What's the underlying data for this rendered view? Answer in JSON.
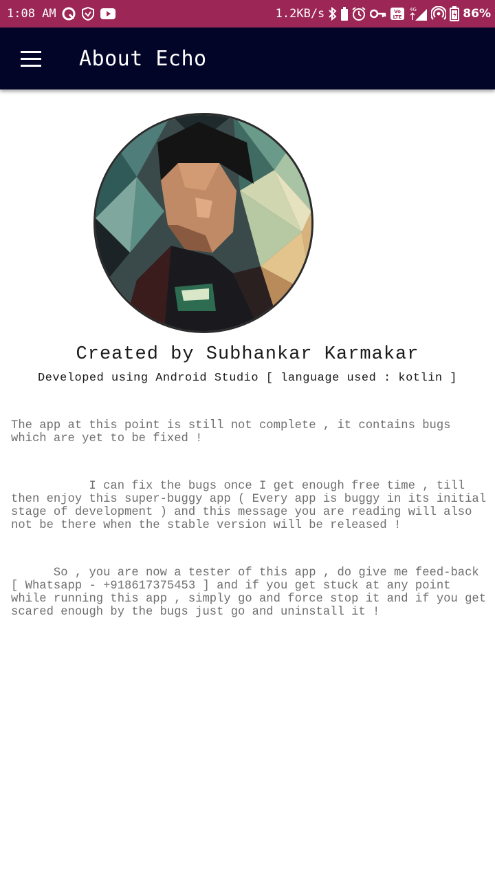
{
  "status_bar": {
    "time": "1:08 AM",
    "net_speed": "1.2KB/s",
    "battery_percent": "86%",
    "network_label": "4G",
    "volte_label": "VoLTE"
  },
  "app_bar": {
    "title": "About Echo"
  },
  "profile": {
    "creator_line": "Created by Subhankar Karmakar",
    "developer_line": "Developed using Android Studio [ language used : kotlin ]"
  },
  "about": {
    "paragraph_1": "The app at this point is still not complete , it contains bugs which are yet to be fixed !",
    "paragraph_2": "           I can fix the bugs once I get enough free time , till then enjoy this super-buggy app ( Every app is buggy in its initial stage of development ) and this message you are reading will also not be there when the stable version will be released !",
    "paragraph_3": "      So , you are now a tester of this app , do give me feed-back [ Whatsapp - +918617375453 ] and if you get stuck at any point while running this app , simply go and force stop it and if you get scared enough by the bugs just go and uninstall it !"
  },
  "colors": {
    "status_bar": "#9c2756",
    "app_bar": "#030528",
    "body_text": "#6e6e6e",
    "heading_text": "#1a1a1a"
  }
}
